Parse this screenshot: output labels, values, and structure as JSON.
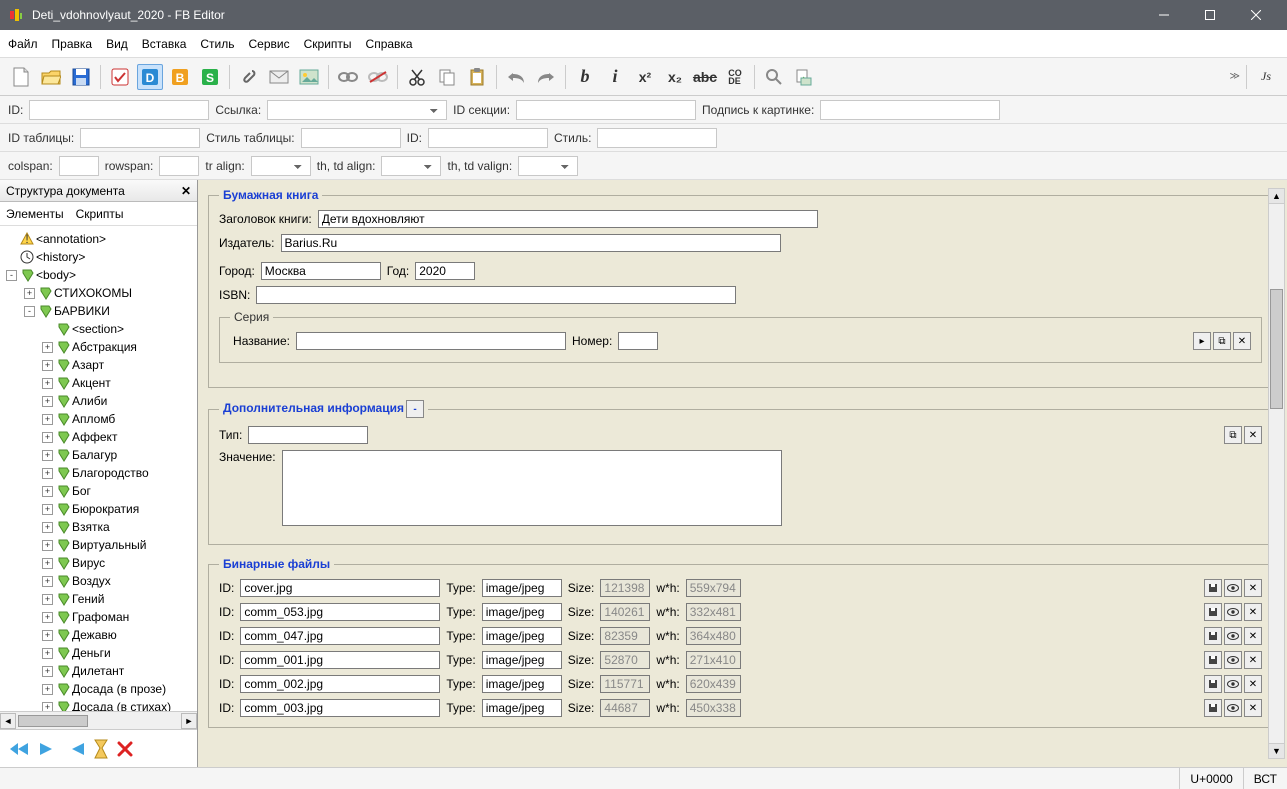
{
  "window": {
    "title": "Deti_vdohnovlyaut_2020 - FB Editor"
  },
  "menu": [
    "Файл",
    "Правка",
    "Вид",
    "Вставка",
    "Стиль",
    "Сервис",
    "Скрипты",
    "Справка"
  ],
  "field_labels": {
    "id": "ID:",
    "href": "Ссылка:",
    "section_id": "ID секции:",
    "img_title": "Подпись к картинке:",
    "table_id": "ID таблицы:",
    "table_style": "Стиль таблицы:",
    "id2": "ID:",
    "style": "Стиль:",
    "colspan": "colspan:",
    "rowspan": "rowspan:",
    "tr_align": "tr align:",
    "thtd_align": "th, td align:",
    "thtd_valign": "th, td valign:"
  },
  "panel": {
    "title": "Структура документа",
    "tabs": [
      "Элементы",
      "Скрипты"
    ]
  },
  "tree": [
    {
      "depth": 0,
      "exp": "",
      "icon": "warn",
      "label": "<annotation>"
    },
    {
      "depth": 0,
      "exp": "",
      "icon": "clock",
      "label": "<history>"
    },
    {
      "depth": 0,
      "exp": "-",
      "icon": "section",
      "label": "<body>"
    },
    {
      "depth": 1,
      "exp": "+",
      "icon": "section",
      "label": "СТИХОКОМЫ"
    },
    {
      "depth": 1,
      "exp": "-",
      "icon": "section",
      "label": "БАРВИКИ"
    },
    {
      "depth": 2,
      "exp": "",
      "icon": "section",
      "label": "<section>"
    },
    {
      "depth": 2,
      "exp": "+",
      "icon": "section",
      "label": "Абстракция"
    },
    {
      "depth": 2,
      "exp": "+",
      "icon": "section",
      "label": "Азарт"
    },
    {
      "depth": 2,
      "exp": "+",
      "icon": "section",
      "label": "Акцент"
    },
    {
      "depth": 2,
      "exp": "+",
      "icon": "section",
      "label": "Алиби"
    },
    {
      "depth": 2,
      "exp": "+",
      "icon": "section",
      "label": "Апломб"
    },
    {
      "depth": 2,
      "exp": "+",
      "icon": "section",
      "label": "Аффект"
    },
    {
      "depth": 2,
      "exp": "+",
      "icon": "section",
      "label": "Балагур"
    },
    {
      "depth": 2,
      "exp": "+",
      "icon": "section",
      "label": "Благородство"
    },
    {
      "depth": 2,
      "exp": "+",
      "icon": "section",
      "label": "Бог"
    },
    {
      "depth": 2,
      "exp": "+",
      "icon": "section",
      "label": "Бюрократия"
    },
    {
      "depth": 2,
      "exp": "+",
      "icon": "section",
      "label": "Взятка"
    },
    {
      "depth": 2,
      "exp": "+",
      "icon": "section",
      "label": "Виртуальный"
    },
    {
      "depth": 2,
      "exp": "+",
      "icon": "section",
      "label": "Вирус"
    },
    {
      "depth": 2,
      "exp": "+",
      "icon": "section",
      "label": "Воздух"
    },
    {
      "depth": 2,
      "exp": "+",
      "icon": "section",
      "label": "Гений"
    },
    {
      "depth": 2,
      "exp": "+",
      "icon": "section",
      "label": "Графоман"
    },
    {
      "depth": 2,
      "exp": "+",
      "icon": "section",
      "label": "Дежавю"
    },
    {
      "depth": 2,
      "exp": "+",
      "icon": "section",
      "label": "Деньги"
    },
    {
      "depth": 2,
      "exp": "+",
      "icon": "section",
      "label": "Дилетант"
    },
    {
      "depth": 2,
      "exp": "+",
      "icon": "section",
      "label": "Досада (в прозе)"
    },
    {
      "depth": 2,
      "exp": "+",
      "icon": "section",
      "label": "Досада (в стихах)"
    }
  ],
  "paper_book": {
    "legend": "Бумажная книга",
    "labels": {
      "book_title": "Заголовок книги:",
      "publisher": "Издатель:",
      "city": "Город:",
      "year": "Год:",
      "isbn": "ISBN:"
    },
    "book_title": "Дети вдохновляют",
    "publisher": "Barius.Ru",
    "city": "Москва",
    "year": "2020",
    "isbn": "",
    "series": {
      "legend": "Серия",
      "name_label": "Название:",
      "number_label": "Номер:",
      "name": "",
      "number": ""
    }
  },
  "extra_info": {
    "legend": "Дополнительная информация",
    "labels": {
      "type": "Тип:",
      "value": "Значение:"
    },
    "type": "",
    "value": ""
  },
  "binary": {
    "legend": "Бинарные файлы",
    "labels": {
      "id": "ID:",
      "type": "Type:",
      "size": "Size:",
      "wh": "w*h:"
    },
    "rows": [
      {
        "id": "cover.jpg",
        "type": "image/jpeg",
        "size": "121398",
        "wh": "559x794"
      },
      {
        "id": "comm_053.jpg",
        "type": "image/jpeg",
        "size": "140261",
        "wh": "332x481"
      },
      {
        "id": "comm_047.jpg",
        "type": "image/jpeg",
        "size": "82359",
        "wh": "364x480"
      },
      {
        "id": "comm_001.jpg",
        "type": "image/jpeg",
        "size": "52870",
        "wh": "271x410"
      },
      {
        "id": "comm_002.jpg",
        "type": "image/jpeg",
        "size": "115771",
        "wh": "620x439"
      },
      {
        "id": "comm_003.jpg",
        "type": "image/jpeg",
        "size": "44687",
        "wh": "450x338"
      }
    ]
  },
  "status": {
    "unicode": "U+0000",
    "mode": "ВСТ"
  }
}
